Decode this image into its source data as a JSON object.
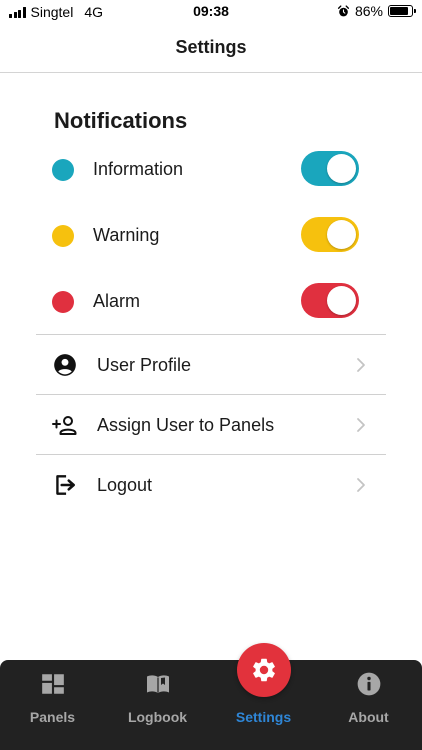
{
  "status_bar": {
    "carrier": "Singtel",
    "network": "4G",
    "time": "09:38",
    "battery": "86%",
    "battery_level": 0.86
  },
  "nav": {
    "title": "Settings"
  },
  "notifications": {
    "title": "Notifications",
    "items": [
      {
        "label": "Information",
        "color": "#1aa6bd",
        "enabled": true
      },
      {
        "label": "Warning",
        "color": "#f6c10e",
        "enabled": true
      },
      {
        "label": "Alarm",
        "color": "#e0303f",
        "enabled": true
      }
    ]
  },
  "menu": {
    "items": [
      {
        "label": "User Profile",
        "icon": "account-circle-icon"
      },
      {
        "label": "Assign User to Panels",
        "icon": "person-add-icon"
      },
      {
        "label": "Logout",
        "icon": "logout-icon"
      }
    ]
  },
  "tab_bar": {
    "tabs": [
      {
        "label": "Panels",
        "icon": "dashboard-icon"
      },
      {
        "label": "Logbook",
        "icon": "book-icon"
      },
      {
        "label": "Settings",
        "icon": "gear-icon",
        "active": true
      },
      {
        "label": "About",
        "icon": "info-icon"
      }
    ],
    "active_color": "#2f86d6",
    "fab_color": "#e2323c"
  }
}
